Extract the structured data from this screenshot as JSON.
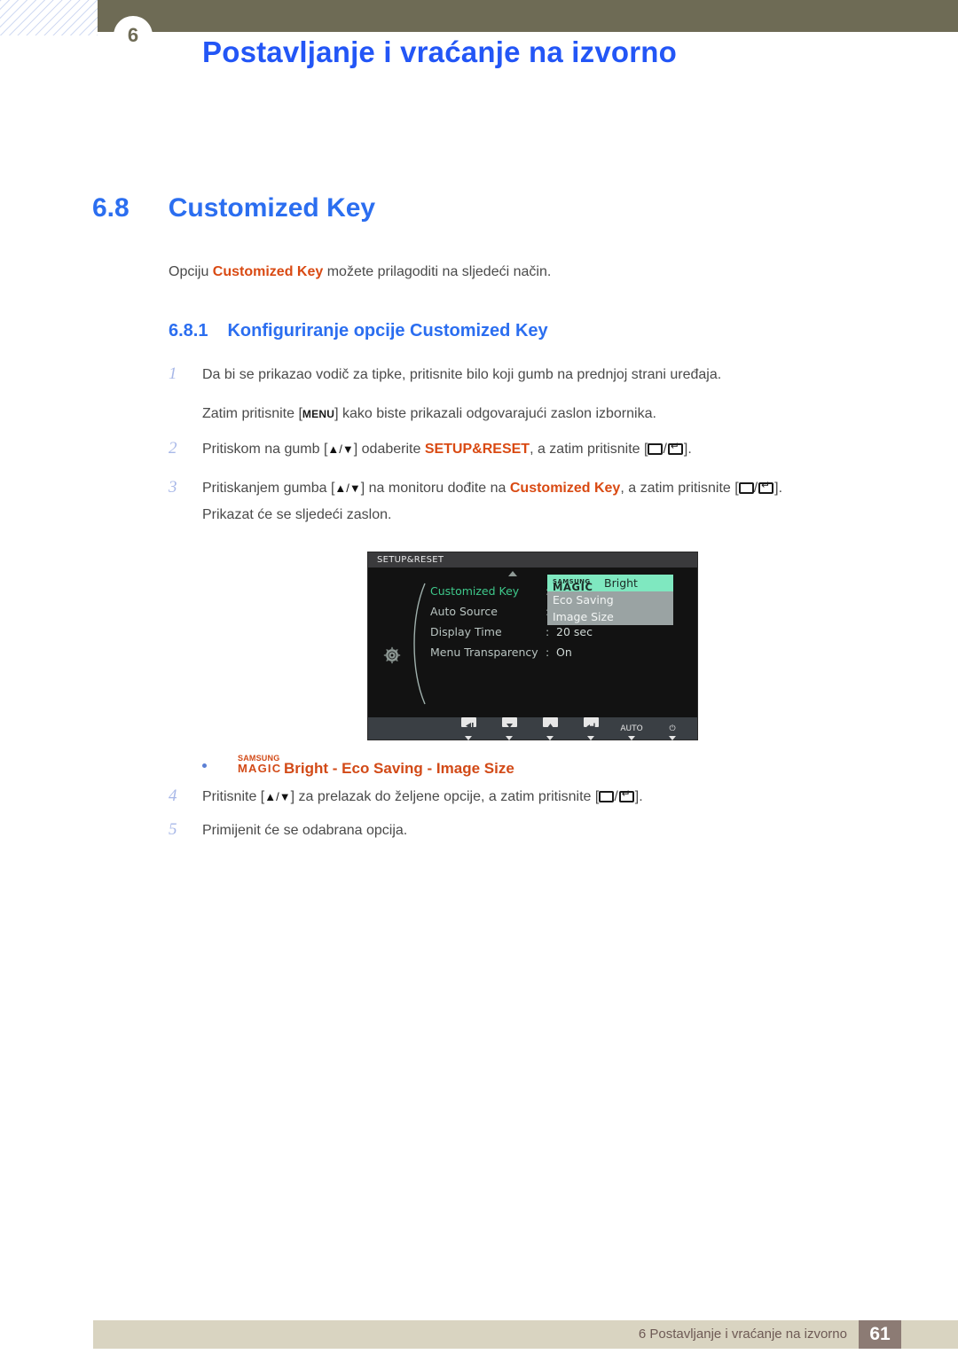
{
  "header": {
    "chapter_number": "6",
    "title": "Postavljanje i vraćanje na izvorno"
  },
  "section": {
    "number": "6.8",
    "title": "Customized Key",
    "intro_before": "Opciju ",
    "intro_highlight": "Customized Key",
    "intro_after": " možete prilagoditi na sljedeći način."
  },
  "subsection": {
    "number": "6.8.1",
    "title": "Konfiguriranje opcije Customized Key"
  },
  "steps": {
    "n1": "1",
    "s1": "Da bi se prikazao vodič za tipke, pritisnite bilo koji gumb na prednjoj strani uređaja.",
    "s1b_before": "Zatim pritisnite [",
    "s1b_key": "MENU",
    "s1b_after": "] kako biste prikazali odgovarajući zaslon izbornika.",
    "n2": "2",
    "s2_a": "Pritiskom na gumb [",
    "s2_arrows": "▲/▼",
    "s2_b": "] odaberite ",
    "s2_hl": "SETUP&RESET",
    "s2_c": ", a zatim pritisnite [",
    "s2_d": "].",
    "n3": "3",
    "s3_a": "Pritiskanjem gumba [",
    "s3_arrows": "▲/▼",
    "s3_b": "] na monitoru dođite na ",
    "s3_hl": "Customized Key",
    "s3_c": ", a zatim pritisnite [",
    "s3_d": "].",
    "s3_sub": "Prikazat će se sljedeći zaslon.",
    "n4": "4",
    "s4_a": "Pritisnite [",
    "s4_arrows": "▲/▼",
    "s4_b": "] za prelazak do željene opcije, a zatim pritisnite [",
    "s4_c": "].",
    "n5": "5",
    "s5": "Primijenit će se odabrana opcija."
  },
  "osd": {
    "title": "SETUP&RESET",
    "rows": [
      {
        "label": "Customized Key",
        "colon": ":",
        "value": "",
        "selected": true
      },
      {
        "label": "Auto Source",
        "colon": ":",
        "value": "",
        "selected": false
      },
      {
        "label": "Display Time",
        "colon": ":",
        "value": "20 sec",
        "selected": false
      },
      {
        "label": "Menu Transparency",
        "colon": ":",
        "value": "On",
        "selected": false
      }
    ],
    "submenu": [
      {
        "brand_top": "SAMSUNG",
        "brand_bottom": "MAGIC",
        "label": "Bright",
        "active": true
      },
      {
        "brand_top": "",
        "brand_bottom": "",
        "label": "Eco Saving",
        "active": false
      },
      {
        "brand_top": "",
        "brand_bottom": "",
        "label": "Image Size",
        "active": false
      }
    ],
    "buttons": [
      {
        "name": "left",
        "glyph": "◀",
        "type": "box"
      },
      {
        "name": "down",
        "glyph": "▼",
        "type": "box"
      },
      {
        "name": "up",
        "glyph": "▲",
        "type": "box"
      },
      {
        "name": "enter",
        "glyph": "↵",
        "type": "box"
      },
      {
        "name": "auto",
        "glyph": "AUTO",
        "type": "text"
      },
      {
        "name": "power",
        "glyph": "⏻",
        "type": "text"
      }
    ],
    "highlight_color": "#7fe8c0",
    "selected_label_color": "#3ec98b"
  },
  "bullet": {
    "brand_top": "SAMSUNG",
    "brand_bottom": "MAGIC",
    "text": "Bright - Eco Saving - Image Size"
  },
  "footer": {
    "text": "6 Postavljanje i vraćanje na izvorno",
    "page": "61"
  },
  "colors": {
    "header_bar": "#6e6b55",
    "heading_blue": "#2b6ef0",
    "accent_orange": "#d94a13",
    "footer_beige": "#d9d4c1",
    "page_box": "#8c7b74"
  }
}
